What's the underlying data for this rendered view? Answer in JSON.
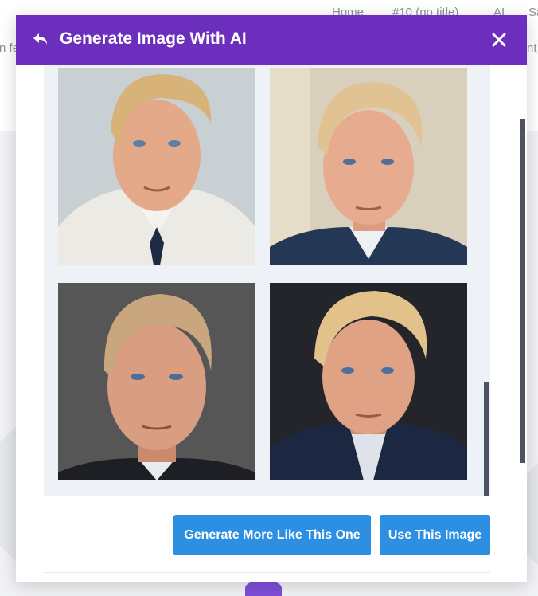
{
  "background": {
    "nav_items": [
      "Home",
      "#10 (no title)",
      "AI",
      "Sa"
    ],
    "left_fragment": "n fe",
    "right_fragment": "nt"
  },
  "modal": {
    "title": "Generate Image With AI",
    "back_icon": "undo-arrow-icon",
    "close_icon": "close-x-icon",
    "header_color": "#6c2ebd",
    "images": [
      {
        "name": "generated-image-1",
        "background": "#c4cccf",
        "clothing": "white-jacket"
      },
      {
        "name": "generated-image-2",
        "background": "#d9d0c0",
        "clothing": "navy-suit"
      },
      {
        "name": "generated-image-3",
        "background": "#4a4a4a",
        "clothing": "dark-suit"
      },
      {
        "name": "generated-image-4",
        "background": "#1f2024",
        "clothing": "navy-suit"
      }
    ],
    "buttons": {
      "generate_more": "Generate More Like This One",
      "use_image": "Use This Image"
    },
    "button_color": "#2d8fe2"
  }
}
